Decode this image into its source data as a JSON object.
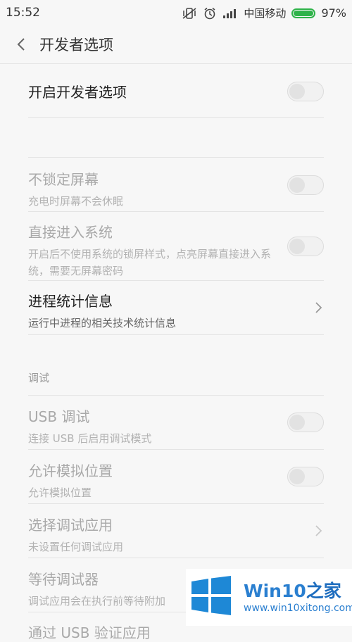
{
  "status_bar": {
    "time": "15:52",
    "carrier": "中国移动",
    "battery_percent": "97%",
    "battery_level": 0.97,
    "battery_color": "#2fb34a",
    "icons": [
      "vibrate-off-icon",
      "alarm-icon",
      "signal-icon",
      "battery-icon"
    ]
  },
  "header": {
    "title": "开发者选项"
  },
  "items": {
    "dev_options": {
      "title": "开启开发者选项",
      "on": false
    },
    "stay_awake": {
      "title": "不锁定屏幕",
      "subtitle": "充电时屏幕不会休眠",
      "on": false
    },
    "direct_boot": {
      "title": "直接进入系统",
      "subtitle": "开启后不使用系统的锁屏样式，点亮屏幕直接进入系统，需要无屏幕密码",
      "on": false
    },
    "process_stats": {
      "title": "进程统计信息",
      "subtitle": "运行中进程的相关技术统计信息"
    },
    "usb_debug": {
      "title": "USB 调试",
      "subtitle": "连接 USB 后启用调试模式",
      "on": false
    },
    "mock_location": {
      "title": "允许模拟位置",
      "subtitle": "允许模拟位置",
      "on": false
    },
    "debug_app": {
      "title": "选择调试应用",
      "subtitle": "未设置任何调试应用"
    },
    "wait_debugger": {
      "title": "等待调试器",
      "subtitle": "调试应用会在执行前等待附加"
    },
    "verify_usb": {
      "title": "通过 USB 验证应用"
    }
  },
  "sections": {
    "debug": "调试"
  },
  "watermark": {
    "brand": "Win10",
    "brand_cn": "之家",
    "url": "www.win10xitong.com"
  }
}
